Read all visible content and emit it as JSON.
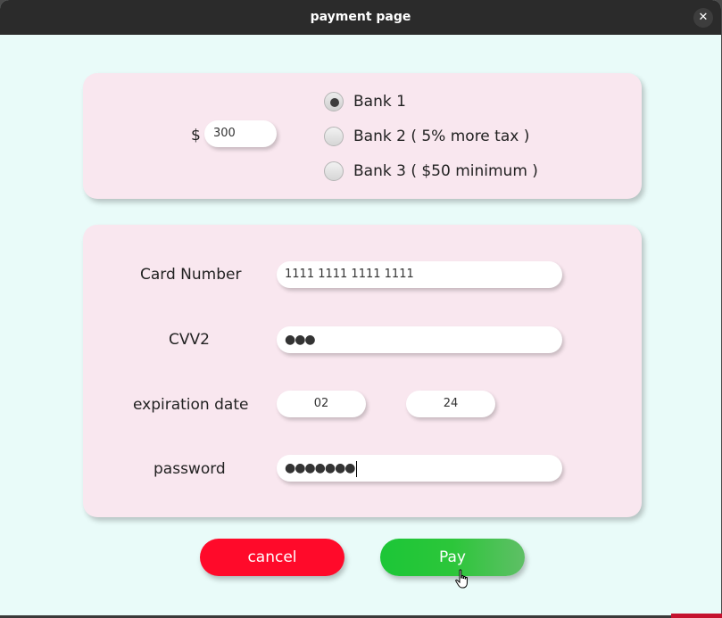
{
  "window": {
    "title": "payment page"
  },
  "amount": {
    "currency_symbol": "$",
    "value": "300"
  },
  "banks": [
    {
      "label": "Bank 1",
      "selected": true
    },
    {
      "label": "Bank 2 ( 5% more tax )",
      "selected": false
    },
    {
      "label": "Bank 3 ( $50 minimum )",
      "selected": false
    }
  ],
  "card_form": {
    "card_number_label": "Card Number",
    "card_number_value": "1111 1111 1111 1111",
    "cvv2_label": "CVV2",
    "cvv2_value": "●●●",
    "expiration_label": "expiration date",
    "expiration_month": "02",
    "expiration_year": "24",
    "password_label": "password",
    "password_value": "●●●●●●●"
  },
  "actions": {
    "cancel_label": "cancel",
    "pay_label": "Pay"
  },
  "colors": {
    "background": "#e9fbf9",
    "card": "#f9e7ef",
    "cancel": "#ff0a2a",
    "pay": "#1cc637"
  }
}
